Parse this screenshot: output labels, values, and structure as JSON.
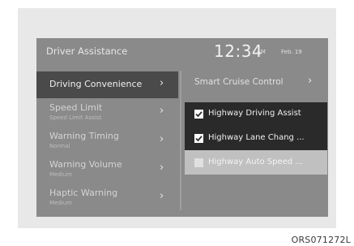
{
  "header": {
    "title": "Driver Assistance",
    "time": "12:34",
    "ampm": "AM",
    "date": "Feb. 19"
  },
  "menu": [
    {
      "label": "Driving Convenience",
      "sub": "",
      "selected": true
    },
    {
      "label": "Speed Limit",
      "sub": "Speed Limit Assist",
      "selected": false
    },
    {
      "label": "Warning Timing",
      "sub": "Normal",
      "selected": false
    },
    {
      "label": "Warning Volume",
      "sub": "Medium",
      "selected": false
    },
    {
      "label": "Haptic Warning",
      "sub": "Medium",
      "selected": false
    }
  ],
  "right_panel": {
    "header_label": "Smart Cruise Control",
    "options": [
      {
        "label": "Highway Driving Assist",
        "checked": true,
        "enabled": true
      },
      {
        "label": "Highway Lane Chang ...",
        "checked": true,
        "enabled": true
      },
      {
        "label": "Highway Auto Speed ...",
        "checked": false,
        "enabled": false
      }
    ]
  },
  "image_code": "ORS071272L",
  "icons": {
    "chevron": "chevron-right-icon",
    "check": "checkmark-icon"
  },
  "colors": {
    "screen_bg": "#8a8a8a",
    "selected_bg": "#4a4a4a",
    "popup_bg": "#2a2a2a",
    "disabled_bg": "#c0c0c0"
  }
}
